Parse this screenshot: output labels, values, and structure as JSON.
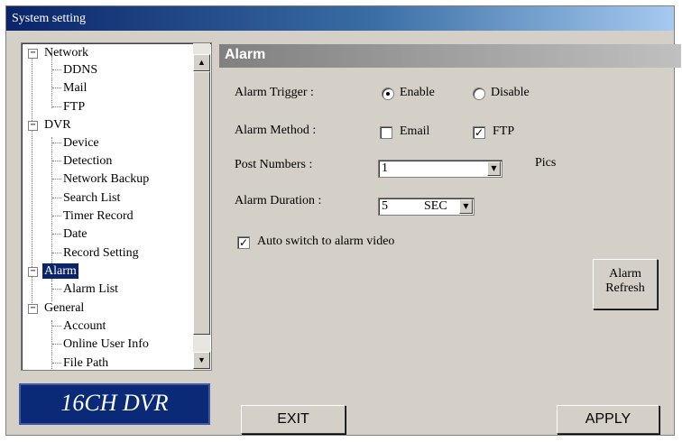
{
  "window": {
    "title": "System setting"
  },
  "tree": {
    "items": [
      {
        "label": "Network",
        "level": 0,
        "expander": "−"
      },
      {
        "label": "DDNS",
        "level": 1
      },
      {
        "label": "Mail",
        "level": 1
      },
      {
        "label": "FTP",
        "level": 1
      },
      {
        "label": "DVR",
        "level": 0,
        "expander": "−"
      },
      {
        "label": "Device",
        "level": 1
      },
      {
        "label": "Detection",
        "level": 1
      },
      {
        "label": "Network Backup",
        "level": 1
      },
      {
        "label": "Search List",
        "level": 1
      },
      {
        "label": "Timer Record",
        "level": 1
      },
      {
        "label": "Date",
        "level": 1
      },
      {
        "label": "Record Setting",
        "level": 1
      },
      {
        "label": "Alarm",
        "level": 0,
        "expander": "−",
        "selected": true
      },
      {
        "label": "Alarm List",
        "level": 1
      },
      {
        "label": "General",
        "level": 0,
        "expander": "−"
      },
      {
        "label": "Account",
        "level": 1
      },
      {
        "label": "Online User Info",
        "level": 1
      },
      {
        "label": "File Path",
        "level": 1
      }
    ],
    "scroll_up_glyph": "▲",
    "scroll_down_glyph": "▼"
  },
  "logo": {
    "text": "16CH DVR"
  },
  "panel": {
    "title": "Alarm",
    "alarm_trigger": {
      "label": "Alarm Trigger :",
      "options": [
        "Enable",
        "Disable"
      ],
      "selected": "Enable"
    },
    "alarm_method": {
      "label": "Alarm Method :",
      "email_label": "Email",
      "email_checked": false,
      "ftp_label": "FTP",
      "ftp_checked": true,
      "check_glyph": "✓"
    },
    "post_numbers": {
      "label": "Post Numbers :",
      "value": "1",
      "unit": "Pics"
    },
    "alarm_duration": {
      "label": "Alarm Duration :",
      "value": "5",
      "unit": "SEC"
    },
    "auto_switch": {
      "label": "Auto switch to alarm video",
      "checked": true
    },
    "refresh_button": {
      "line1": "Alarm",
      "line2": "Refresh"
    },
    "dropdown_glyph": "▼"
  },
  "buttons": {
    "exit": "EXIT",
    "apply": "APPLY"
  }
}
